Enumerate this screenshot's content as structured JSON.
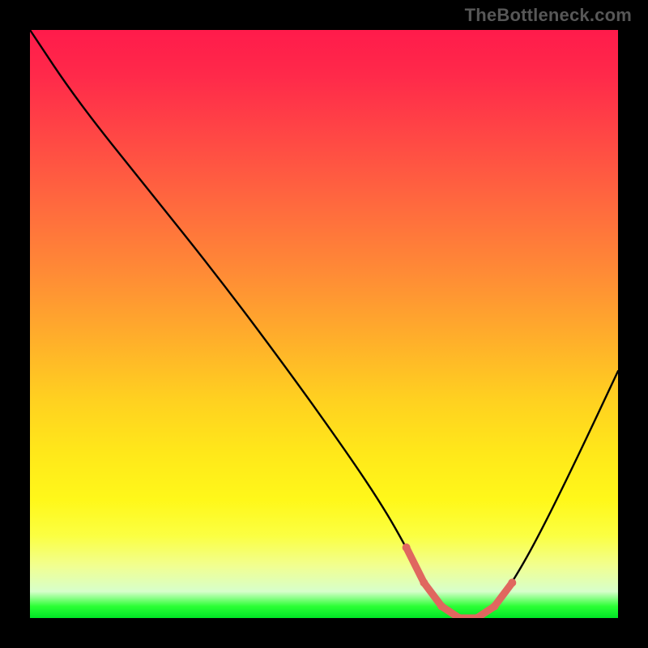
{
  "watermark": "TheBottleneck.com",
  "chart_data": {
    "type": "line",
    "title": "",
    "xlabel": "",
    "ylabel": "",
    "xlim": [
      0,
      100
    ],
    "ylim": [
      0,
      100
    ],
    "grid": false,
    "curve_note": "Bottleneck-style V curve; y is bottleneck percent (0 = green bottom, 100 = red top). Dip centered ~x=74.",
    "x": [
      0,
      8,
      20,
      32,
      44,
      54,
      60,
      64,
      67,
      70,
      73,
      76,
      79,
      82,
      86,
      92,
      100
    ],
    "bottleneck_y": [
      100,
      88,
      73,
      58,
      42,
      28,
      19,
      12,
      6,
      2,
      0,
      0,
      2,
      6,
      13,
      25,
      42
    ],
    "valley_highlight": {
      "color": "#e0675f",
      "points_x": [
        64,
        67,
        70,
        73,
        76,
        79,
        82
      ],
      "points_y": [
        12,
        6,
        2,
        0,
        0,
        2,
        6
      ]
    }
  }
}
